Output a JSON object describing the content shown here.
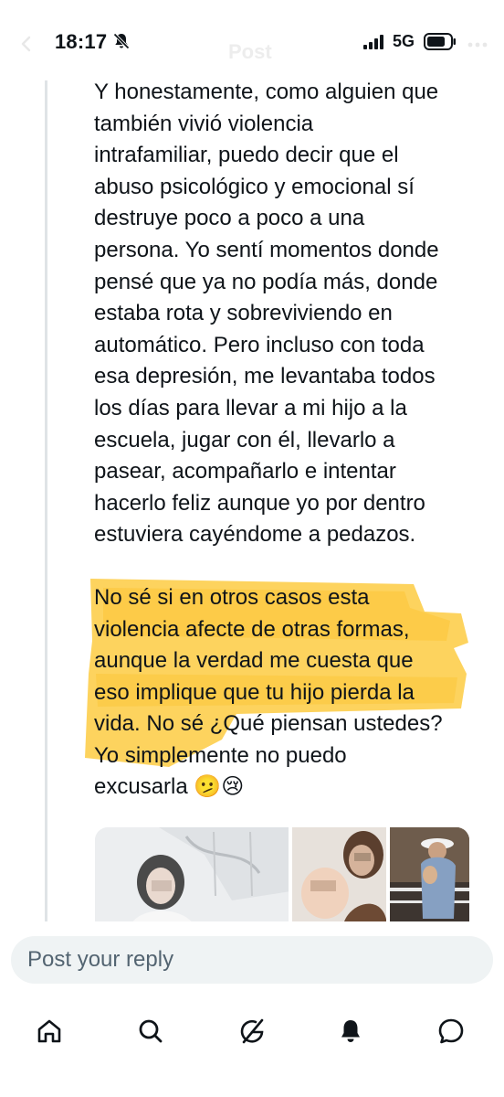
{
  "status_bar": {
    "time": "18:17",
    "network": "5G",
    "ghost_title": "Post"
  },
  "tweet": {
    "paragraph1": "Y honestamente, como alguien que\ntambién vivió violencia\nintrafamiliar, puedo decir que el\nabuso psicológico y emocional sí\ndestruye poco a poco a una\npersona. Yo sentí momentos donde\npensé que ya no podía más, donde\nestaba rota y sobreviviendo en\nautomático. Pero incluso con toda\nesa depresión, me levantaba todos\nlos días para llevar a mi hijo a la\nescuela, jugar con él, llevarlo a\npasear, acompañarlo e intentar\nhacerlo feliz aunque yo por dentro\nestuviera cayéndome a pedazos.",
    "paragraph2": "No sé si en otros casos esta\nviolencia afecte de otras formas,\naunque la verdad me cuesta que\neso implique que tu hijo pierda la\nvida. No sé ¿Qué piensan ustedes?\nYo simplemente no puedo\nexcusarla 🫤😢",
    "highlight_color": "#fcc93a"
  },
  "reply": {
    "placeholder": "Post your reply"
  },
  "nav": {
    "items": [
      "home-icon",
      "search-icon",
      "grok-icon",
      "notifications-icon",
      "messages-icon"
    ]
  },
  "colors": {
    "text": "#0f1419",
    "muted": "#536471",
    "input_bg": "#eff3f4",
    "thread_line": "#dfe3e6"
  }
}
